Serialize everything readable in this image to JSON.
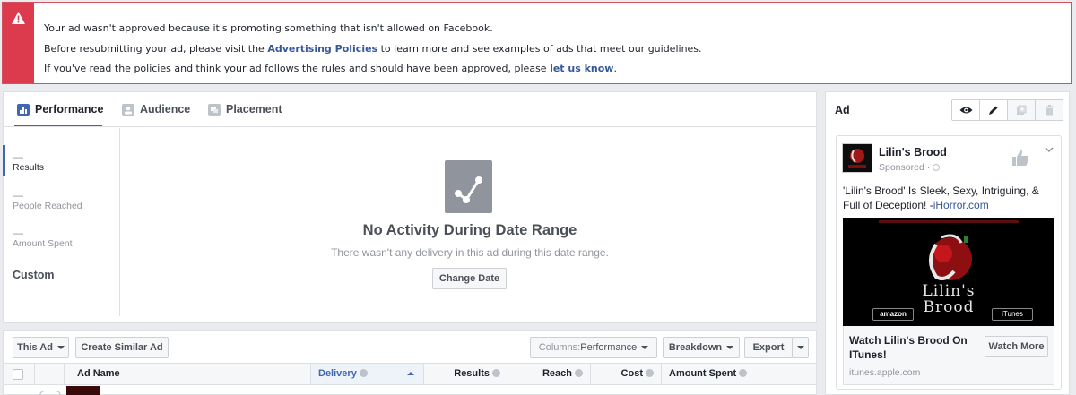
{
  "alert": {
    "line1": "Your ad wasn't approved because it's promoting something that isn't allowed on Facebook.",
    "line2_before": "Before resubmitting your ad, please visit the ",
    "line2_link": "Advertising Policies",
    "line2_after": " to learn more and see examples of ads that meet our guidelines.",
    "line3_before": "If you've read the policies and think your ad follows the rules and should have been approved, please ",
    "line3_link": "let us know",
    "line3_after": "."
  },
  "tabs": [
    "Performance",
    "Audience",
    "Placement"
  ],
  "metrics": [
    {
      "dash": "—",
      "label": "Results"
    },
    {
      "dash": "—",
      "label": "People Reached"
    },
    {
      "dash": "—",
      "label": "Amount Spent"
    }
  ],
  "custom_label": "Custom",
  "empty": {
    "title": "No Activity During Date Range",
    "subtitle": "There wasn't any delivery in this ad during this date range.",
    "button": "Change Date"
  },
  "toolbar": {
    "this_ad": "This Ad",
    "create_similar": "Create Similar Ad",
    "columns_prefix": "Columns: ",
    "columns_value": "Performance",
    "breakdown": "Breakdown",
    "export": "Export"
  },
  "table": {
    "headers": [
      "Ad Name",
      "Delivery",
      "Results",
      "Reach",
      "Cost",
      "Amount Spent"
    ]
  },
  "ad_preview": {
    "label": "Ad",
    "page_name": "Lilin's Brood",
    "sponsored": "Sponsored · ",
    "text_before": "'Lilin's Brood' Is Sleek, Sexy, Intriguing, & Full of Deception! -",
    "text_link": "iHorror.com",
    "cta_title": "Watch Lilin's Brood On ITunes!",
    "cta_domain": "itunes.apple.com",
    "cta_button": "Watch More",
    "creative_title_line1": "Lilin's",
    "creative_title_line2": "Brood",
    "badge_amazon": "amazon",
    "badge_itunes": "iTunes"
  },
  "colors": {
    "alert_red": "#dc3a4d",
    "link_blue": "#365899",
    "accent_blue": "#4267b2"
  }
}
